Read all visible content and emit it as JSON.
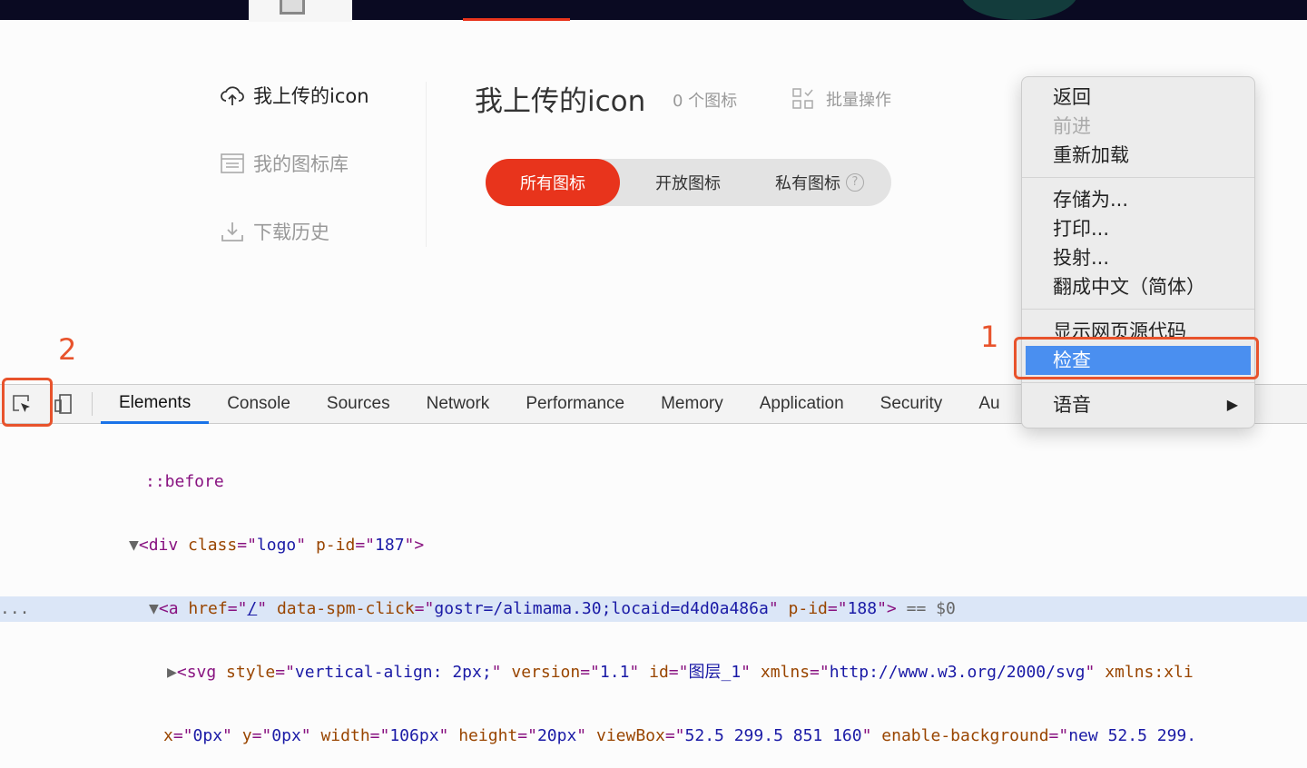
{
  "sidebar": {
    "items": [
      {
        "label": "我上传的icon",
        "icon": "cloud-upload-icon"
      },
      {
        "label": "我的图标库",
        "icon": "library-icon"
      },
      {
        "label": "下载历史",
        "icon": "download-icon"
      }
    ]
  },
  "main": {
    "title": "我上传的icon",
    "count": "0 个图标",
    "batch": "批量操作",
    "tabs": [
      "所有图标",
      "开放图标",
      "私有图标"
    ],
    "help": "?"
  },
  "annotations": {
    "one": "1",
    "two": "2"
  },
  "devtools": {
    "tabs": [
      "Elements",
      "Console",
      "Sources",
      "Network",
      "Performance",
      "Memory",
      "Application",
      "Security",
      "Au"
    ],
    "code": {
      "l1": "::before",
      "l2": {
        "tag": "div",
        "attr1": "class",
        "val1": "logo",
        "attr2": "p-id",
        "val2": "187"
      },
      "l3": {
        "tag": "a",
        "attr1": "href",
        "val1": "/",
        "attr2": "data-spm-click",
        "val2": "gostr=/alimama.30;locaid=d4d0a486a",
        "attr3": "p-id",
        "val3": "188",
        "suffix": " == $0",
        "dots": "..."
      },
      "l4": {
        "tag": "svg",
        "attrs": [
          [
            "style",
            "vertical-align: 2px;"
          ],
          [
            "version",
            "1.1"
          ],
          [
            "id",
            "图层_1"
          ],
          [
            "xmlns",
            "http://www.w3.org/2000/svg"
          ]
        ],
        "tail": "xmlns:xli"
      },
      "l5": {
        "attrs": [
          [
            "x",
            "0px"
          ],
          [
            "y",
            "0px"
          ],
          [
            "width",
            "106px"
          ],
          [
            "height",
            "20px"
          ],
          [
            "viewBox",
            "52.5 299.5 851 160"
          ]
        ],
        "tail": "enable-background",
        "tailval": "new 52.5 299."
      }
    }
  },
  "context_menu": {
    "items": [
      "返回",
      "前进",
      "重新加载",
      "存储为...",
      "打印...",
      "投射...",
      "翻成中文（简体）",
      "显示网页源代码",
      "检查",
      "语音"
    ],
    "submenu_arrow": "▶"
  },
  "colors": {
    "accent": "#e8341c",
    "annotation": "#e8532c",
    "highlight": "#4a8ff0"
  }
}
